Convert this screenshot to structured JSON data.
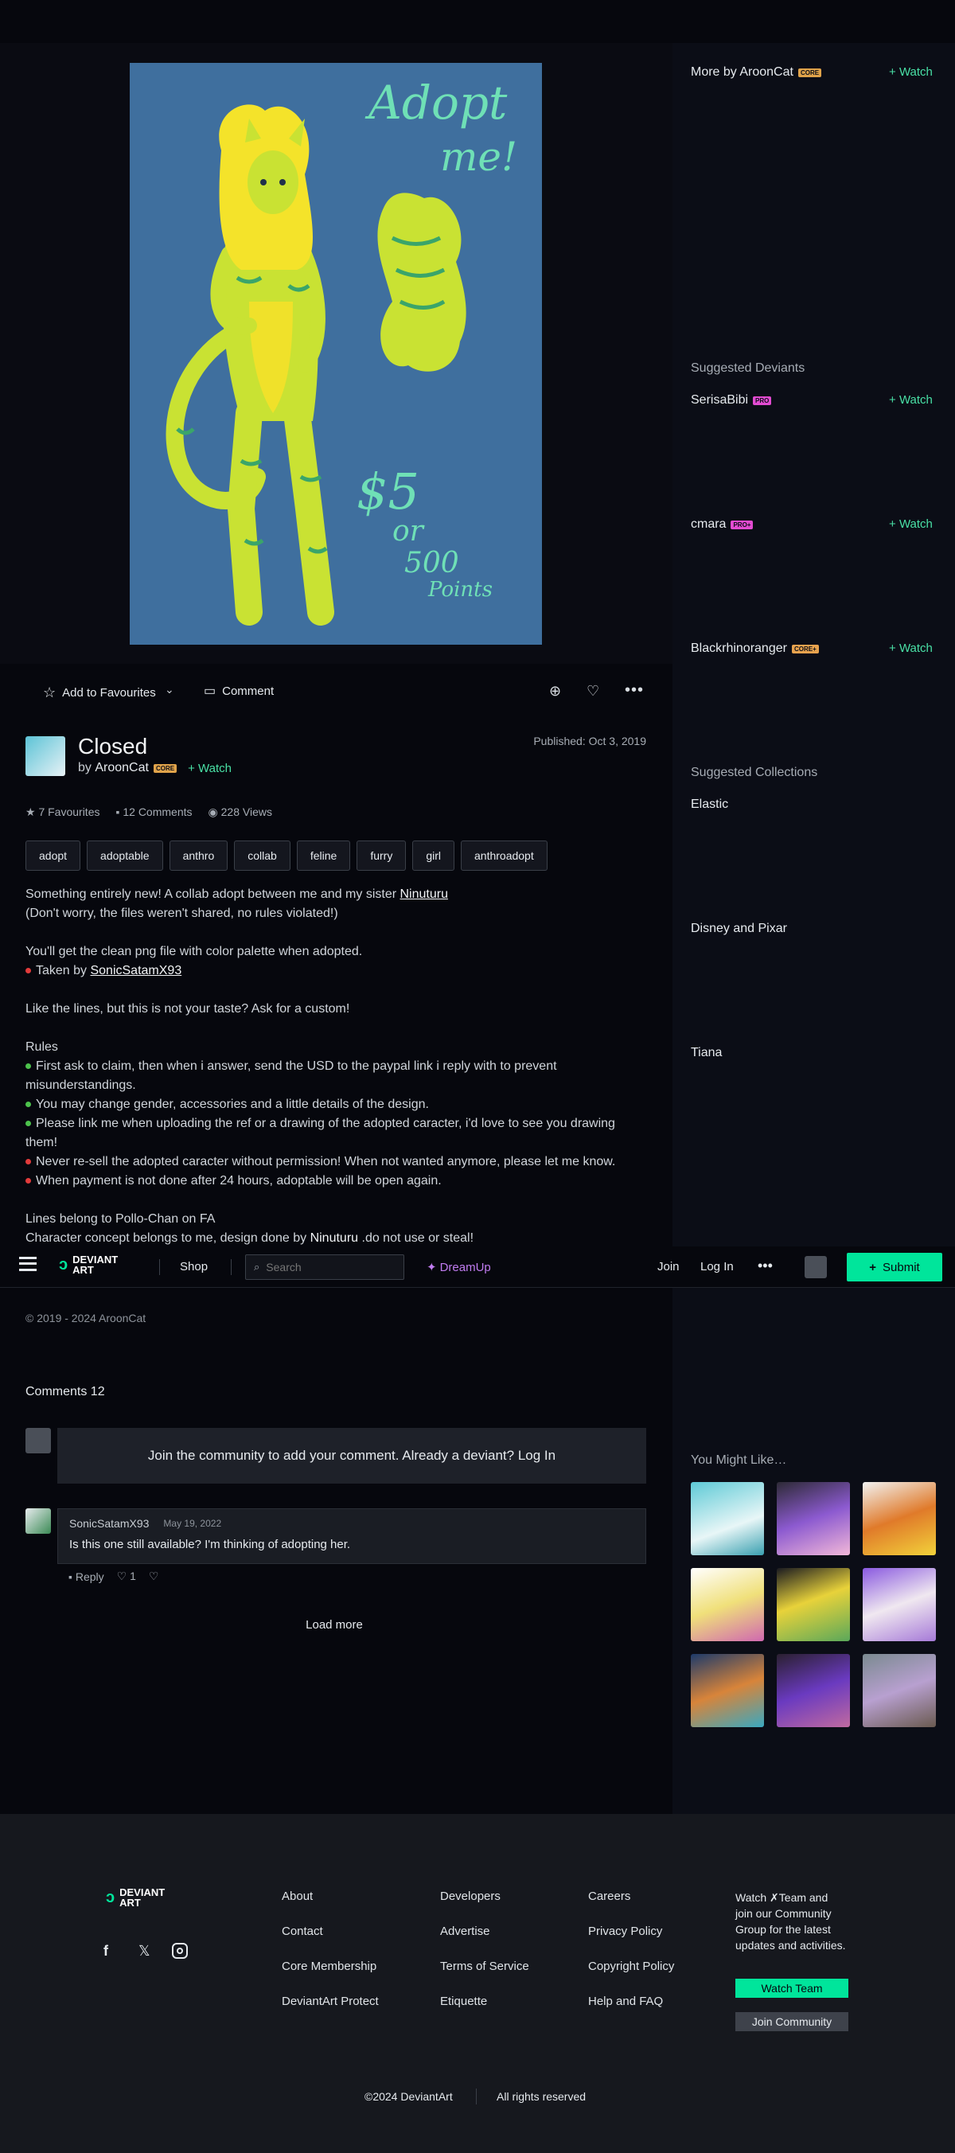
{
  "sidebar": {
    "more_by": "More by AroonCat",
    "more_by_badge": "CORE",
    "watch_label": "Watch",
    "suggested_deviants_title": "Suggested Deviants",
    "deviants": [
      {
        "name": "SerisaBibi",
        "badge": "PRO"
      },
      {
        "name": "cmara",
        "badge": "PRO+"
      },
      {
        "name": "Blackrhinoranger",
        "badge": "CORE+"
      }
    ],
    "suggested_collections_title": "Suggested Collections",
    "collections": [
      "Elastic",
      "Disney and Pixar",
      "Tiana"
    ],
    "you_might_like_title": "You Might Like…"
  },
  "actions": {
    "add_favourites": "Add to Favourites",
    "comment": "Comment"
  },
  "deviation": {
    "title": "Closed",
    "by": "by",
    "author": "AroonCat",
    "author_badge": "CORE",
    "watch": "Watch",
    "published": "Published: Oct 3, 2019",
    "favourites": "7 Favourites",
    "comments": "12 Comments",
    "views": "228 Views",
    "tags": [
      "adopt",
      "adoptable",
      "anthro",
      "collab",
      "feline",
      "furry",
      "girl",
      "anthroadopt"
    ],
    "desc_line1_pre": "Something entirely new! A collab adopt between me and my sister ",
    "desc_line1_link": "Ninuturu",
    "desc_line2": "(Don't worry, the files weren't shared, no rules violated!)",
    "desc_line3": "You'll get the clean png file with color palette when adopted.",
    "desc_line4_pre": "Taken by ",
    "desc_line4_link": "SonicSatamX93",
    "desc_line5": "Like the lines, but this is not your taste? Ask for a custom!",
    "rules_title": "Rules",
    "rules": [
      {
        "color": "green",
        "text": "First ask to claim, then when i answer, send the USD to the paypal link i reply with to prevent misunderstandings."
      },
      {
        "color": "green",
        "text": "You may change gender, accessories and a little details of the design."
      },
      {
        "color": "green",
        "text": "Please link me when uploading the ref or a drawing of the adopted caracter, i'd love to see you drawing them!"
      },
      {
        "color": "red",
        "text": "Never re-sell the adopted caracter without permission! When not wanted anymore, please let me know."
      },
      {
        "color": "red",
        "text": "When payment is not done after 24 hours, adoptable will be open again."
      }
    ],
    "lines_belong": "Lines belong to Pollo-Chan on FA",
    "concept_pre": "Character concept belongs to me, design done by ",
    "concept_link": "Ninuturu",
    "concept_post": " .do not use or steal!",
    "copyright": "© 2019 - 2024 AroonCat"
  },
  "navbar": {
    "brand_line1": "DEVIANT",
    "brand_line2": "ART",
    "shop": "Shop",
    "search_placeholder": "Search",
    "dreamup": "DreamUp",
    "join": "Join",
    "login": "Log In",
    "submit": "Submit"
  },
  "comments": {
    "title": "Comments 12",
    "join_prompt": "Join the community to add your comment. Already a deviant? Log In",
    "items": [
      {
        "author": "SonicSatamX93",
        "date": "May 19, 2022",
        "text": "Is this one still available? I'm thinking of adopting her.",
        "reply": "Reply",
        "likes": "1"
      }
    ],
    "load_more": "Load more"
  },
  "art_text": {
    "adopt": "Adopt",
    "me": "me!",
    "price": "$5",
    "or": "or",
    "points_num": "500",
    "points": "Points"
  },
  "footer": {
    "brand_line1": "DEVIANT",
    "brand_line2": "ART",
    "col1": [
      "About",
      "Contact",
      "Core Membership",
      "DeviantArt Protect"
    ],
    "col2": [
      "Developers",
      "Advertise",
      "Terms of Service",
      "Etiquette"
    ],
    "col3": [
      "Careers",
      "Privacy Policy",
      "Copyright Policy",
      "Help and FAQ"
    ],
    "team_text": "Watch ✗Team and join our Community Group for the latest updates and activities.",
    "watch_team": "Watch Team",
    "join_community": "Join Community",
    "copyright": "©2024 DeviantArt",
    "rights": "All rights reserved"
  },
  "colors": {
    "accent": "#49e0a6",
    "submit": "#00e59b",
    "dreamup": "#c07cf0",
    "bg": "#06070d",
    "panel": "#1a1d24"
  }
}
